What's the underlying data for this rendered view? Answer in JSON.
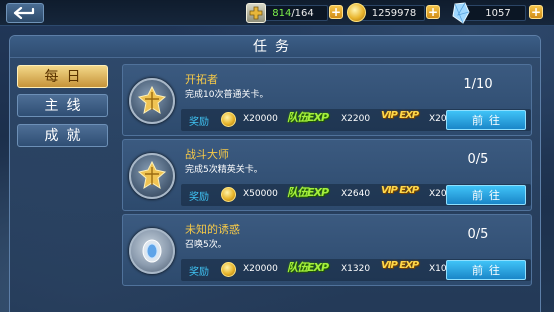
{
  "topbar": {
    "stamina": {
      "current": "814",
      "max": "/164",
      "icon": "stamina-cross-icon"
    },
    "gold": {
      "value": "1259978",
      "icon": "gold-coin-icon"
    },
    "crystal": {
      "value": "1057",
      "icon": "crystal-icon"
    },
    "back_icon": "back-arrow-icon"
  },
  "panel": {
    "title": "任务"
  },
  "tabs": [
    {
      "label": "每日",
      "active": true
    },
    {
      "label": "主线",
      "active": false
    },
    {
      "label": "成就",
      "active": false
    }
  ],
  "quests": [
    {
      "title": "开拓者",
      "desc": "完成10次普通关卡。",
      "progress": "1/10",
      "reward_label": "奖励",
      "gold": "X20000",
      "team_exp_label": "队伍EXP",
      "team_exp": "X2200",
      "vip_exp_label": "VIP EXP",
      "vip_exp": "X20",
      "button": "前往",
      "medal": "gold-shield-medal-icon"
    },
    {
      "title": "战斗大师",
      "desc": "完成5次精英关卡。",
      "progress": "0/5",
      "reward_label": "奖励",
      "gold": "X50000",
      "team_exp_label": "队伍EXP",
      "team_exp": "X2640",
      "vip_exp_label": "VIP EXP",
      "vip_exp": "X20",
      "button": "前往",
      "medal": "gold-shield-medal-icon"
    },
    {
      "title": "未知的诱惑",
      "desc": "召唤5次。",
      "progress": "0/5",
      "reward_label": "奖励",
      "gold": "X20000",
      "team_exp_label": "队伍EXP",
      "team_exp": "X1320",
      "vip_exp_label": "VIP EXP",
      "vip_exp": "X10",
      "button": "前往",
      "medal": "blue-gem-medal-icon"
    }
  ],
  "colors": {
    "title_gold": "#f6c948",
    "reward_blue": "#3fc2f2",
    "button_blue": "#1a86c8",
    "tab_active": "#e5bd62"
  }
}
